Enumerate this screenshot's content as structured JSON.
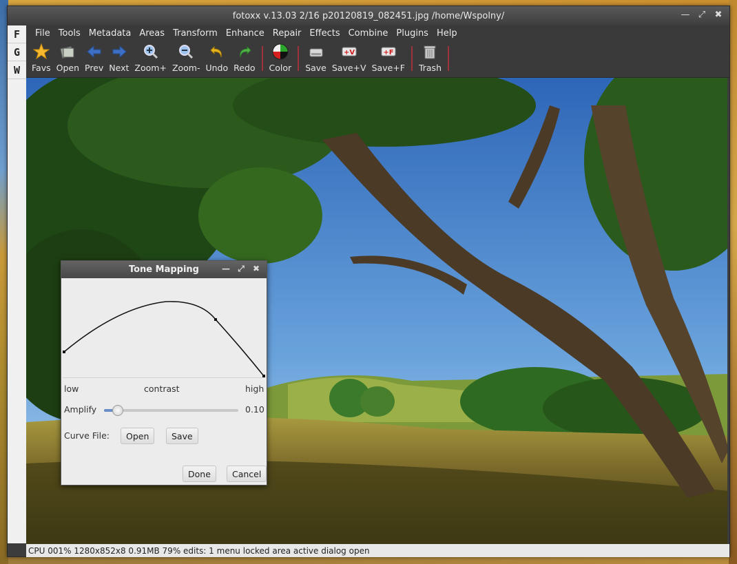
{
  "window": {
    "title": "fotoxx v.13.03  2/16  p20120819_082451.jpg  /home/Wspolny/"
  },
  "side_tabs": [
    "F",
    "G",
    "W"
  ],
  "menu": [
    "File",
    "Tools",
    "Metadata",
    "Areas",
    "Transform",
    "Enhance",
    "Repair",
    "Effects",
    "Combine",
    "Plugins",
    "Help"
  ],
  "toolbar": {
    "favs": "Favs",
    "open": "Open",
    "prev": "Prev",
    "next": "Next",
    "zoom_in": "Zoom+",
    "zoom_out": "Zoom-",
    "undo": "Undo",
    "redo": "Redo",
    "color": "Color",
    "save": "Save",
    "save_v": "Save+V",
    "save_f": "Save+F",
    "trash": "Trash"
  },
  "status": "CPU 001%  1280x852x8  0.91MB  79%  edits: 1  menu locked  area active  dialog open",
  "dialog": {
    "title": "Tone Mapping",
    "low": "low",
    "contrast": "contrast",
    "high": "high",
    "amplify_label": "Amplify",
    "amplify_value": "0.10",
    "amplify_fraction": 0.1,
    "curve_file_label": "Curve File:",
    "open": "Open",
    "save": "Save",
    "done": "Done",
    "cancel": "Cancel"
  },
  "colors": {
    "toolbar_bg": "#3a3a3a",
    "accent": "#6a8fc8",
    "separator": "#a0333a"
  }
}
